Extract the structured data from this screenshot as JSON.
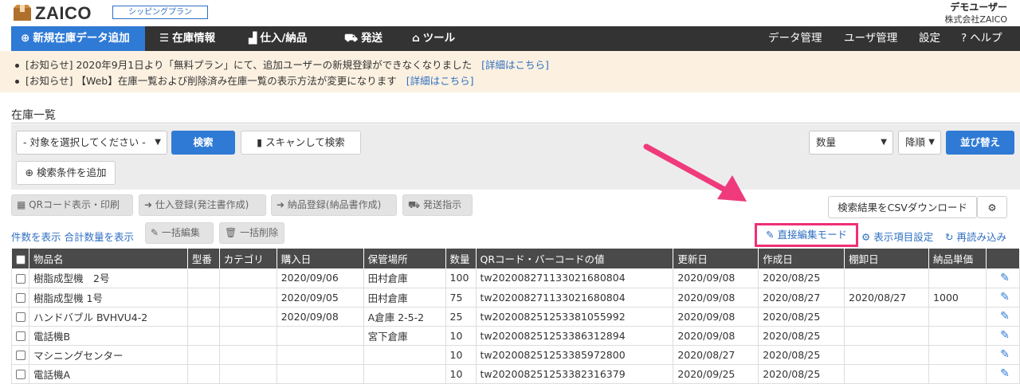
{
  "header": {
    "logo_text": "ZAICO",
    "plan_badge": "シッピングプラン",
    "user_name": "デモユーザー",
    "company": "株式会社ZAICO"
  },
  "nav": {
    "add": "新規在庫データ追加",
    "stock": "在庫情報",
    "purchase": "仕入/納品",
    "ship": "発送",
    "tools": "ツール",
    "data_mgmt": "データ管理",
    "user_mgmt": "ユーザ管理",
    "settings": "設定",
    "help": "ヘルプ"
  },
  "notices": [
    {
      "text": "[お知らせ] 2020年9月1日より「無料プラン」にて、追加ユーザーの新規登録ができなくなりました",
      "link": "[詳細はこちら]"
    },
    {
      "text": "[お知らせ] 【Web】在庫一覧および削除済み在庫一覧の表示方法が変更になります",
      "link": "[詳細はこちら]"
    }
  ],
  "page_title": "在庫一覧",
  "search": {
    "target_placeholder": "- 対象を選択してください -",
    "search_label": "検索",
    "scan_label": "スキャンして検索",
    "add_condition": "検索条件を追加",
    "sort_field": "数量",
    "sort_order": "降順",
    "sort_button": "並び替え"
  },
  "actions": {
    "qr": "QRコード表示・印刷",
    "purchase_reg": "仕入登録(発注書作成)",
    "delivery_reg": "納品登録(納品書作成)",
    "ship": "発送指示",
    "csv": "検索結果をCSVダウンロード",
    "count_link": "件数を表示 合計数量を表示",
    "bulk_edit": "一括編集",
    "bulk_delete": "一括削除",
    "direct_edit": "直接編集モード",
    "display_settings": "表示項目設定",
    "reload": "再読み込み"
  },
  "table": {
    "headers": [
      "物品名",
      "型番",
      "カテゴリ",
      "購入日",
      "保管場所",
      "数量",
      "QRコード・バーコードの値",
      "更新日",
      "作成日",
      "棚卸日",
      "納品単価"
    ],
    "rows": [
      [
        "樹脂成型機　2号",
        "",
        "",
        "2020/09/06",
        "田村倉庫",
        "100",
        "tw20200827113302168080​4",
        "2020/09/08",
        "2020/08/25",
        "",
        ""
      ],
      [
        "樹脂成型機 1号",
        "",
        "",
        "2020/09/05",
        "田村倉庫",
        "75",
        "tw202008271133021680804",
        "2020/09/08",
        "2020/08/27",
        "2020/08/27",
        "1000"
      ],
      [
        "ハンドバブル BVHVU4-2",
        "",
        "",
        "2020/09/08",
        "A倉庫 2-5-2",
        "25",
        "tw202008251253381055992",
        "2020/09/08",
        "2020/08/25",
        "",
        ""
      ],
      [
        "電話機B",
        "",
        "",
        "",
        "宮下倉庫",
        "10",
        "tw202008251253386312894",
        "2020/09/08",
        "2020/08/25",
        "",
        ""
      ],
      [
        "マシニングセンター",
        "",
        "",
        "",
        "",
        "10",
        "tw202008251253385972800",
        "2020/08/27",
        "2020/08/25",
        "",
        ""
      ],
      [
        "電話機A",
        "",
        "",
        "",
        "",
        "10",
        "tw202008251253382316379",
        "2020/09/25",
        "2020/08/25",
        "",
        ""
      ]
    ]
  },
  "colors": {
    "accent": "#2f7ad5",
    "nav_bg": "#333333",
    "highlight": "#ef2f77",
    "notice_bg": "#fcf1e1"
  }
}
